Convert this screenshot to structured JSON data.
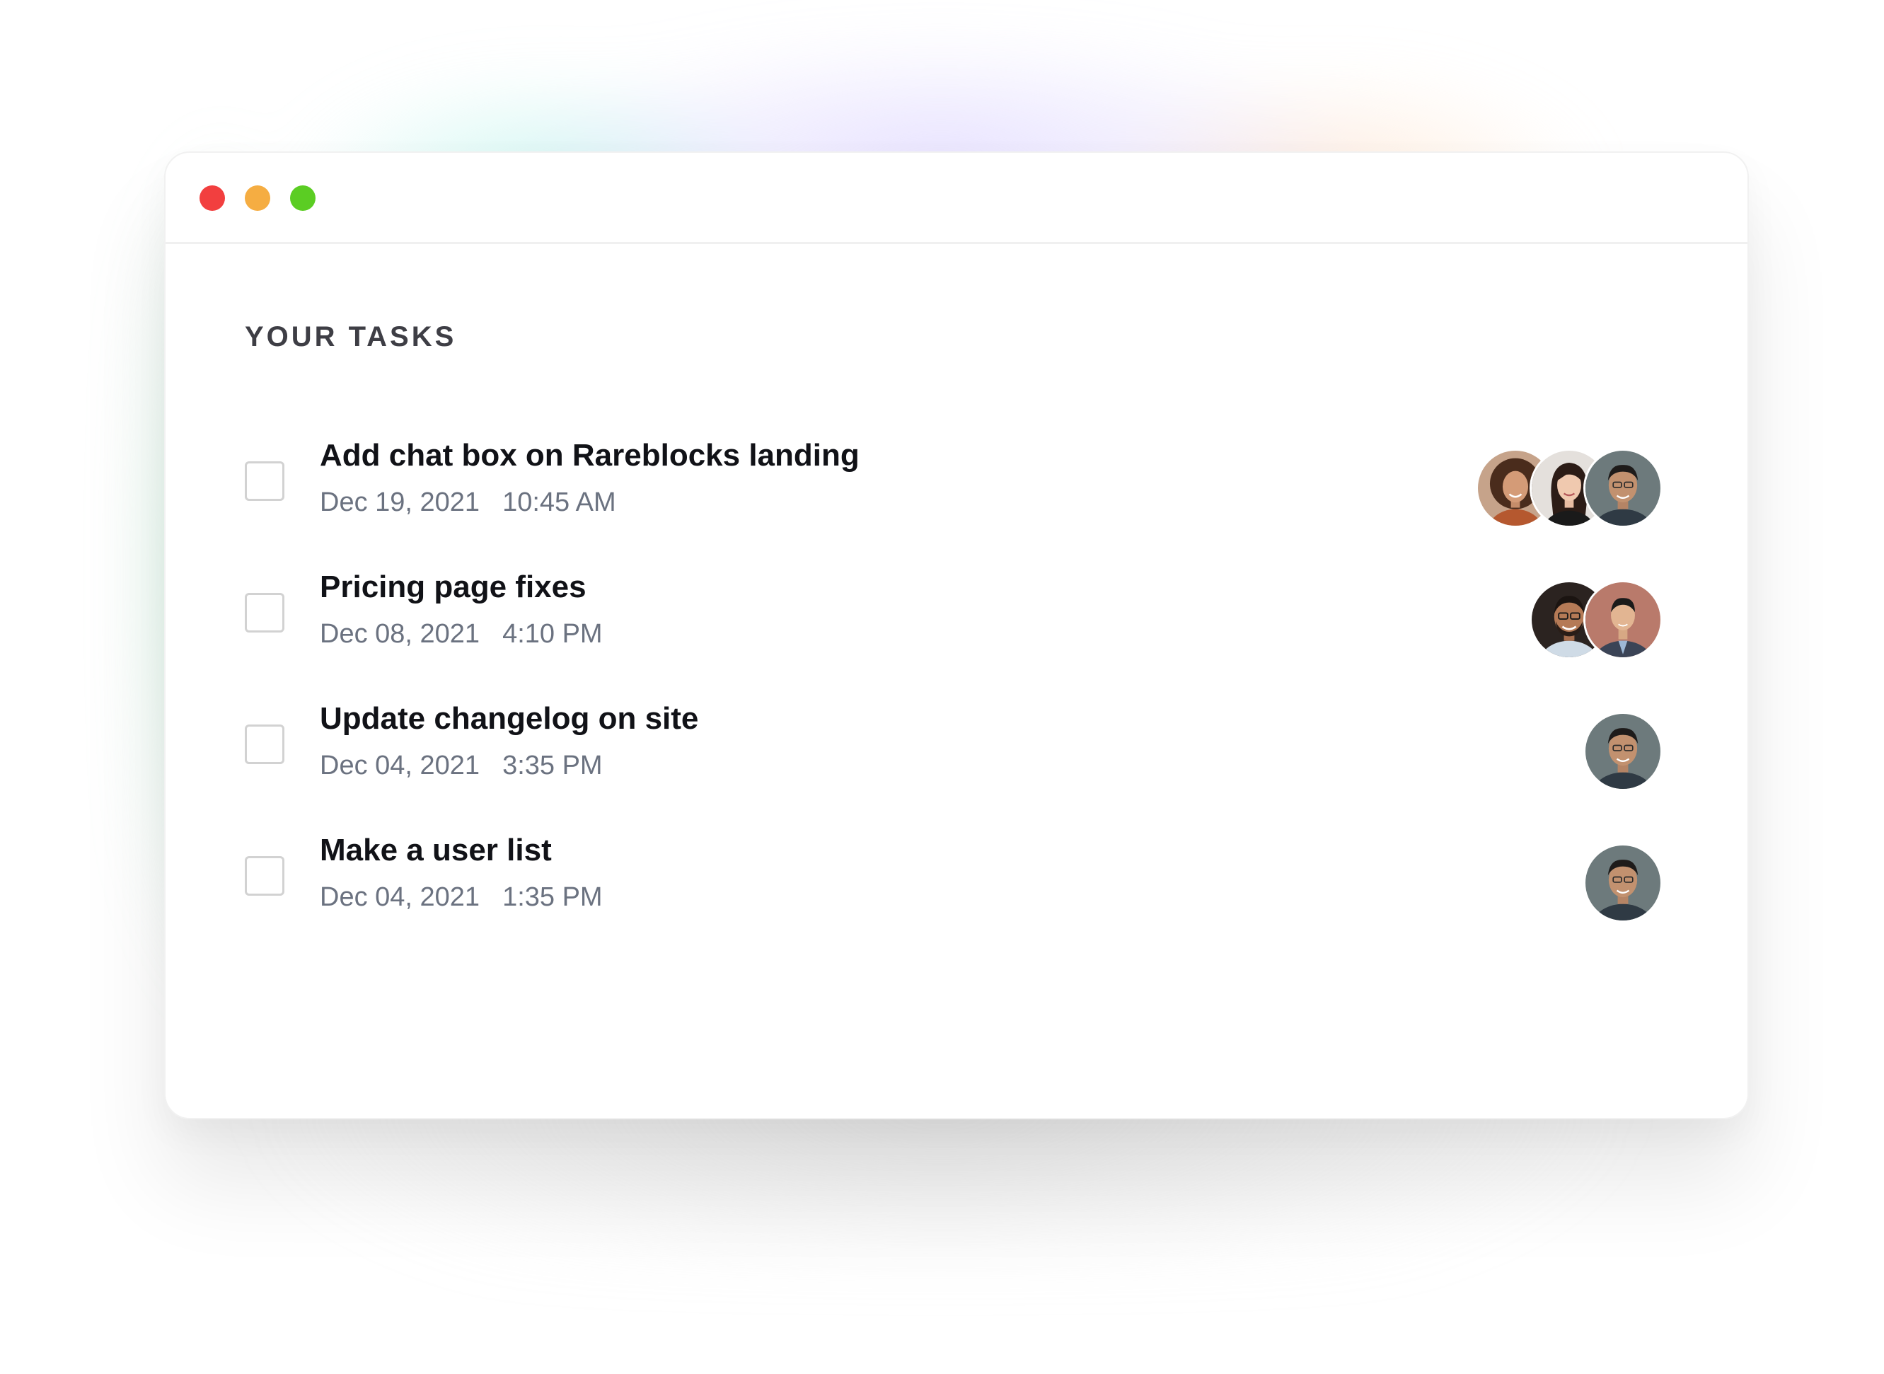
{
  "window": {
    "traffic_lights": [
      {
        "name": "close",
        "color": "#f23f3f"
      },
      {
        "name": "minimize",
        "color": "#f5ad42"
      },
      {
        "name": "maximize",
        "color": "#5bcd23"
      }
    ]
  },
  "heading": "YOUR TASKS",
  "tasks": [
    {
      "title": "Add chat box on Rareblocks landing",
      "date": "Dec 19, 2021",
      "time": "10:45 AM",
      "assignees": [
        "avatar-woman-curly-hair",
        "avatar-woman-dark-hair",
        "avatar-man-glasses"
      ]
    },
    {
      "title": "Pricing page fixes",
      "date": "Dec 08, 2021",
      "time": "4:10 PM",
      "assignees": [
        "avatar-man-glasses-beard",
        "avatar-man-suit"
      ]
    },
    {
      "title": "Update changelog on site",
      "date": "Dec 04, 2021",
      "time": "3:35 PM",
      "assignees": [
        "avatar-man-glasses"
      ]
    },
    {
      "title": "Make a user list",
      "date": "Dec 04, 2021",
      "time": "1:35 PM",
      "assignees": [
        "avatar-man-glasses"
      ]
    }
  ],
  "colors": {
    "heading": "#3e3e45",
    "title": "#111217",
    "meta": "#6b7280",
    "checkbox_border": "#d2d2d2"
  }
}
